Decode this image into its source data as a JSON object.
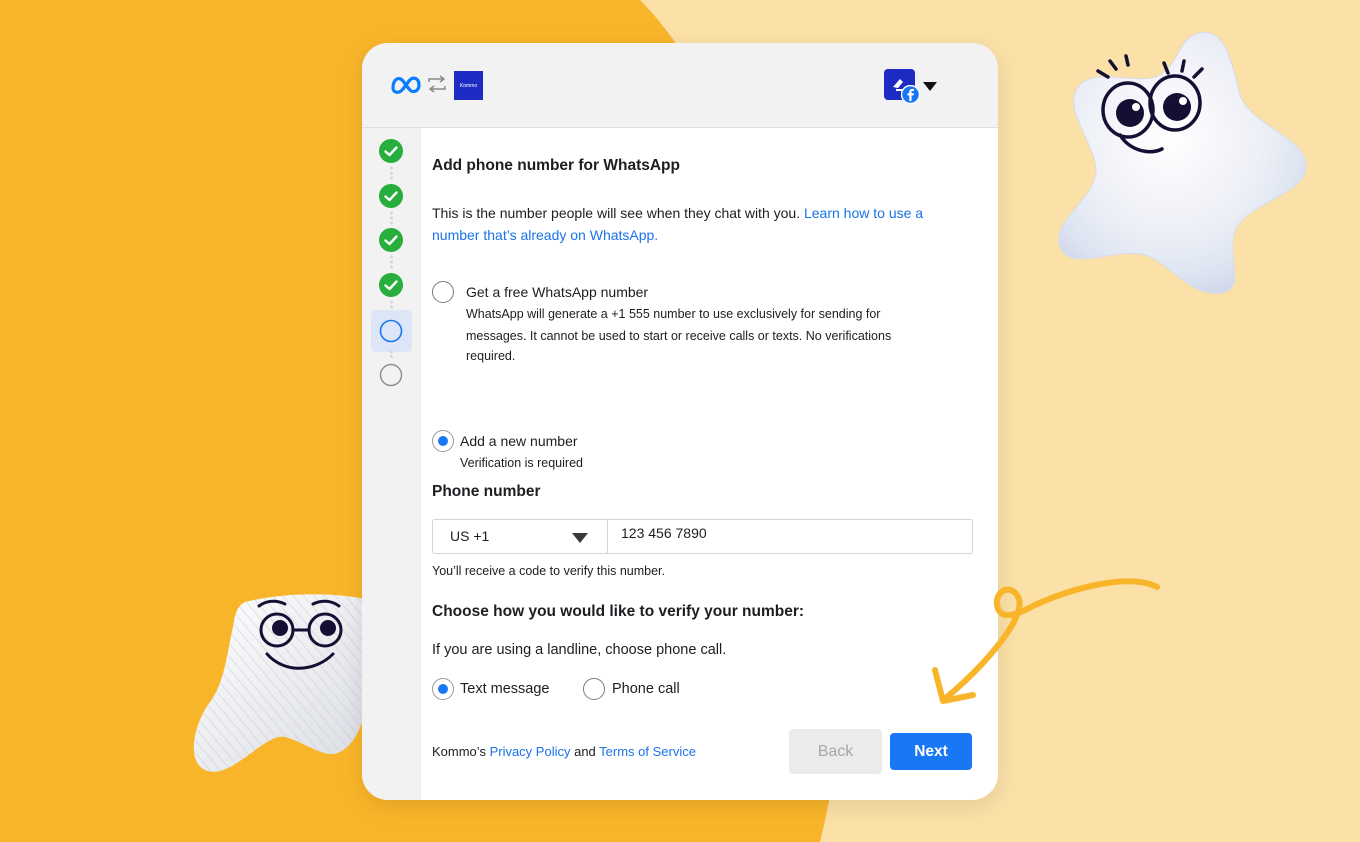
{
  "colors": {
    "background_orange": "#f9b52a",
    "background_cream": "#fbe1a7",
    "primary_blue": "#1877f2",
    "link_blue": "#1a73e8",
    "step_done_green": "#27ae3c",
    "kommo_navy": "#1d2bc2"
  },
  "header": {
    "kommo_logo_text": "Kommo",
    "icons": [
      "meta-logo-icon",
      "swap-arrows-icon",
      "kommo-logo",
      "facebook-badge-icon",
      "caret-down-icon"
    ]
  },
  "steps": [
    {
      "state": "done"
    },
    {
      "state": "done"
    },
    {
      "state": "done"
    },
    {
      "state": "done"
    },
    {
      "state": "current"
    },
    {
      "state": "todo"
    }
  ],
  "main": {
    "title": "Add phone number for WhatsApp",
    "description": "This is the number people will see when they chat with you. ",
    "description_link": "Learn how to use a number that’s already on WhatsApp.",
    "options": [
      {
        "label": "Get a free WhatsApp number",
        "detail_1": "WhatsApp will generate a +1 555 number to use exclusively for sending for",
        "detail_2": "messages. It cannot be used to start or receive calls or texts. No verifications",
        "detail_3": "required.",
        "selected": false
      },
      {
        "label": "Add a new number",
        "detail": "Verification is required",
        "selected": true
      }
    ],
    "phone_heading": "Phone number",
    "country_code": "US +1",
    "phone_value": "123 456 7890",
    "phone_help": "You’ll receive a code to verify this number.",
    "verify_heading": "Choose how you would like to verify your number:",
    "verify_help": "If you are using a landline, choose phone call.",
    "verify_methods": [
      {
        "label": "Text message",
        "selected": true
      },
      {
        "label": "Phone call",
        "selected": false
      }
    ]
  },
  "footer": {
    "prefix": "Kommo’s ",
    "privacy_link": "Privacy Policy",
    "and": " and ",
    "terms_link": "Terms of Service",
    "back_label": "Back",
    "next_label": "Next"
  }
}
